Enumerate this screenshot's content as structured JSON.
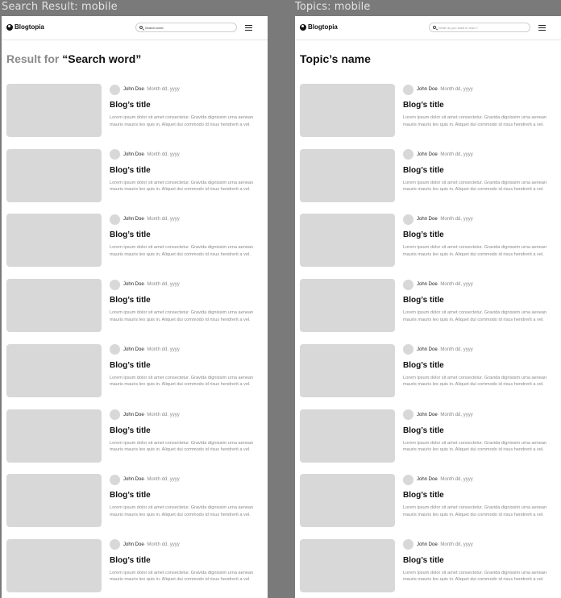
{
  "frames": {
    "search": {
      "label": "Search Result: mobile"
    },
    "topics": {
      "label": "Topics: mobile"
    }
  },
  "brand": {
    "name": "Blogtopia"
  },
  "search_page": {
    "search_value": "Search word",
    "heading_prefix": "Result for ",
    "heading_term": "“Search word”"
  },
  "topics_page": {
    "search_placeholder": "What do you want to read ?",
    "heading": "Topic’s name"
  },
  "post": {
    "author": "John Doe",
    "date": " · Month dd, yyyy",
    "title": "Blog’s title",
    "excerpt": "Lorem ipsum dolor sit amet consectetur. Gravida dignissim urna aenean mauris mauris leo quis in. Aliquet dui commodo id risus hendrerit a vel."
  },
  "colors": {
    "canvas": "#7a7a7a",
    "frame": "#ffffff",
    "placeholder_fill": "#d8d8d8",
    "muted_text": "#8a8a8a"
  },
  "icons": [
    "globe-icon",
    "search-icon",
    "menu-icon"
  ]
}
